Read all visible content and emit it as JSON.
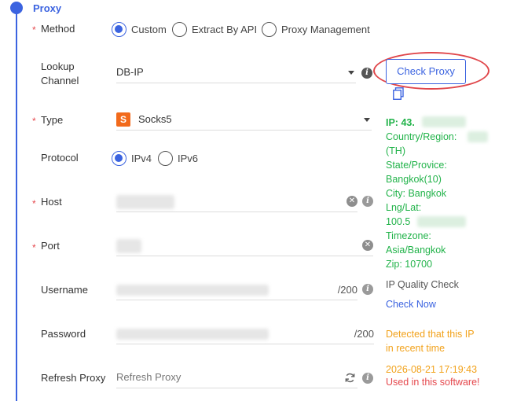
{
  "section": {
    "title": "Proxy"
  },
  "method": {
    "label": "Method",
    "options": [
      "Custom",
      "Extract By API",
      "Proxy Management"
    ],
    "selected": "Custom"
  },
  "lookup": {
    "label_line1": "Lookup",
    "label_line2": "Channel",
    "value": "DB-IP"
  },
  "check_proxy": {
    "label": "Check Proxy"
  },
  "type": {
    "label": "Type",
    "value": "Socks5",
    "icon_letter": "S"
  },
  "protocol": {
    "label": "Protocol",
    "options": [
      "IPv4",
      "IPv6"
    ],
    "selected": "IPv4"
  },
  "host": {
    "label": "Host"
  },
  "port": {
    "label": "Port"
  },
  "username": {
    "label": "Username",
    "counter": "/200"
  },
  "password": {
    "label": "Password",
    "counter": "/200"
  },
  "refresh": {
    "label": "Refresh Proxy",
    "placeholder": "Refresh Proxy"
  },
  "ip_info": {
    "ip": "IP:  43.",
    "country_label": "Country/Region:",
    "country_value": "(TH)",
    "state_label": "State/Provice:",
    "state_value": "Bangkok(10)",
    "city": "City: Bangkok",
    "lnglat_label": "Lng/Lat:",
    "lnglat_value": " 100.5",
    "timezone_label": "Timezone:",
    "timezone_value": " Asia/Bangkok",
    "zip": "Zip:  10700"
  },
  "ip_quality": {
    "label": "IP Quality Check",
    "check_now": "Check Now"
  },
  "detection": {
    "line1": "Detected that this IP",
    "line2": "in recent time",
    "timestamp": "2026-08-21 17:19:43",
    "used": "Used in this software!"
  },
  "colors": {
    "accent": "#3b63e0",
    "success": "#22b34a",
    "warning": "#f2a21b",
    "danger": "#e5484d"
  }
}
